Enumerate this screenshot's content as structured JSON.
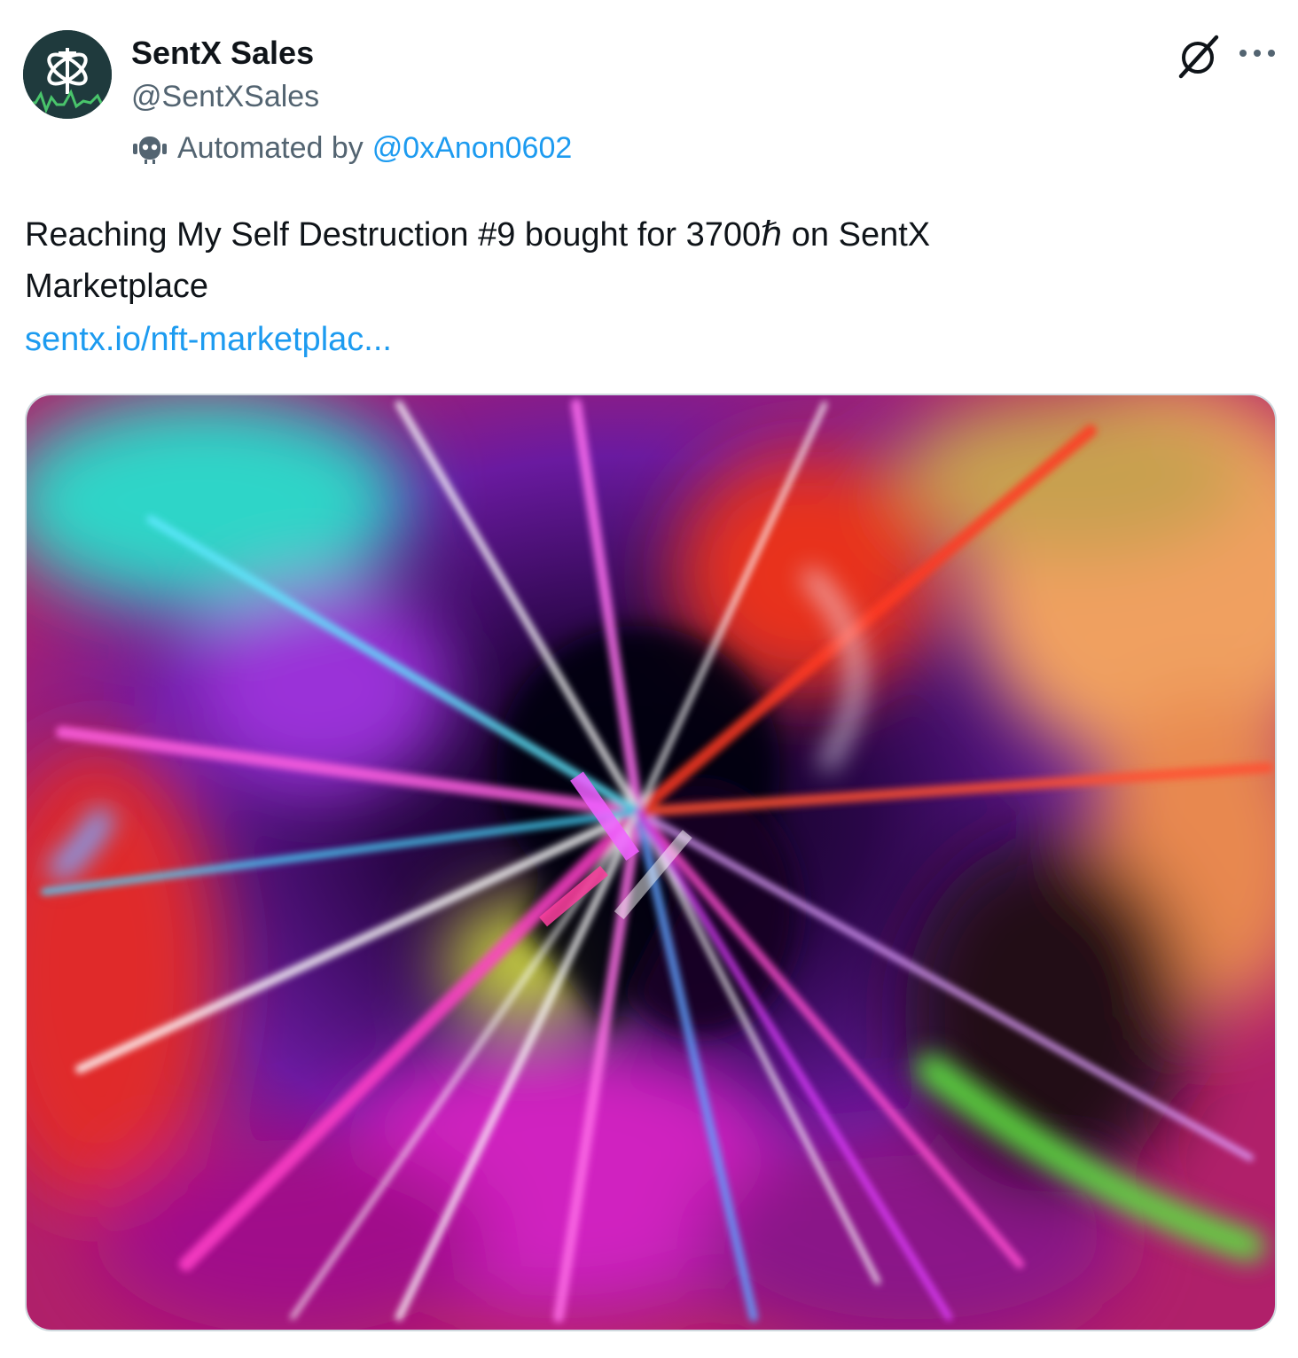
{
  "tweet": {
    "author": {
      "display_name": "SentX Sales",
      "handle": "@SentXSales",
      "avatar_icon": "sentx-logo-icon"
    },
    "automated_label": "Automated by",
    "automated_by_handle": "@0xAnon0602",
    "text_line_1": "Reaching My Self Destruction #9 bought for 3700ℏ  on SentX",
    "text_line_2": "Marketplace",
    "link_text": "sentx.io/nft-marketplac...",
    "media_alt": "abstract colorful explosion artwork",
    "icons": {
      "grok": "grok-icon",
      "more": "more-options-icon",
      "robot": "robot-icon"
    },
    "colors": {
      "link": "#1d9bf0",
      "secondary_text": "#536471",
      "primary_text": "#0f1419"
    }
  }
}
